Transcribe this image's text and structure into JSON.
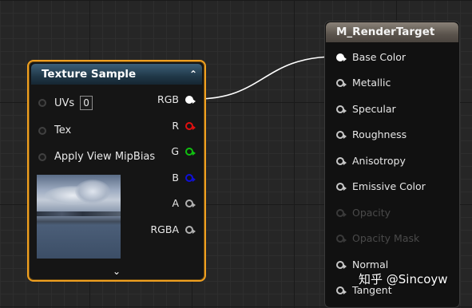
{
  "texture_node": {
    "title": "Texture Sample",
    "collapse_glyph": "⌃",
    "expand_glyph": "⌄",
    "inputs": [
      {
        "label": "UVs",
        "value": "0"
      },
      {
        "label": "Tex"
      },
      {
        "label": "Apply View MipBias"
      }
    ],
    "outputs": [
      {
        "label": "RGB",
        "pin": "white-filled"
      },
      {
        "label": "R",
        "pin": "red"
      },
      {
        "label": "G",
        "pin": "green"
      },
      {
        "label": "B",
        "pin": "blue"
      },
      {
        "label": "A",
        "pin": "gray"
      },
      {
        "label": "RGBA",
        "pin": "gray"
      }
    ],
    "preview_icon": "sky-texture-thumbnail"
  },
  "material_node": {
    "title": "M_RenderTarget",
    "inputs": [
      {
        "label": "Base Color",
        "connected": true,
        "enabled": true
      },
      {
        "label": "Metallic",
        "connected": false,
        "enabled": true
      },
      {
        "label": "Specular",
        "connected": false,
        "enabled": true
      },
      {
        "label": "Roughness",
        "connected": false,
        "enabled": true
      },
      {
        "label": "Anisotropy",
        "connected": false,
        "enabled": true
      },
      {
        "label": "Emissive Color",
        "connected": false,
        "enabled": true
      },
      {
        "label": "Opacity",
        "connected": false,
        "enabled": false
      },
      {
        "label": "Opacity Mask",
        "connected": false,
        "enabled": false
      },
      {
        "label": "Normal",
        "connected": false,
        "enabled": true
      },
      {
        "label": "Tangent",
        "connected": false,
        "enabled": true
      }
    ]
  },
  "watermark": "知乎 @Sincoyw",
  "colors": {
    "selection_outline": "#f0a020",
    "texture_header": "#2c4a5e",
    "material_header": "#6e675f",
    "wire": "#ffffff",
    "canvas": "#262626"
  }
}
